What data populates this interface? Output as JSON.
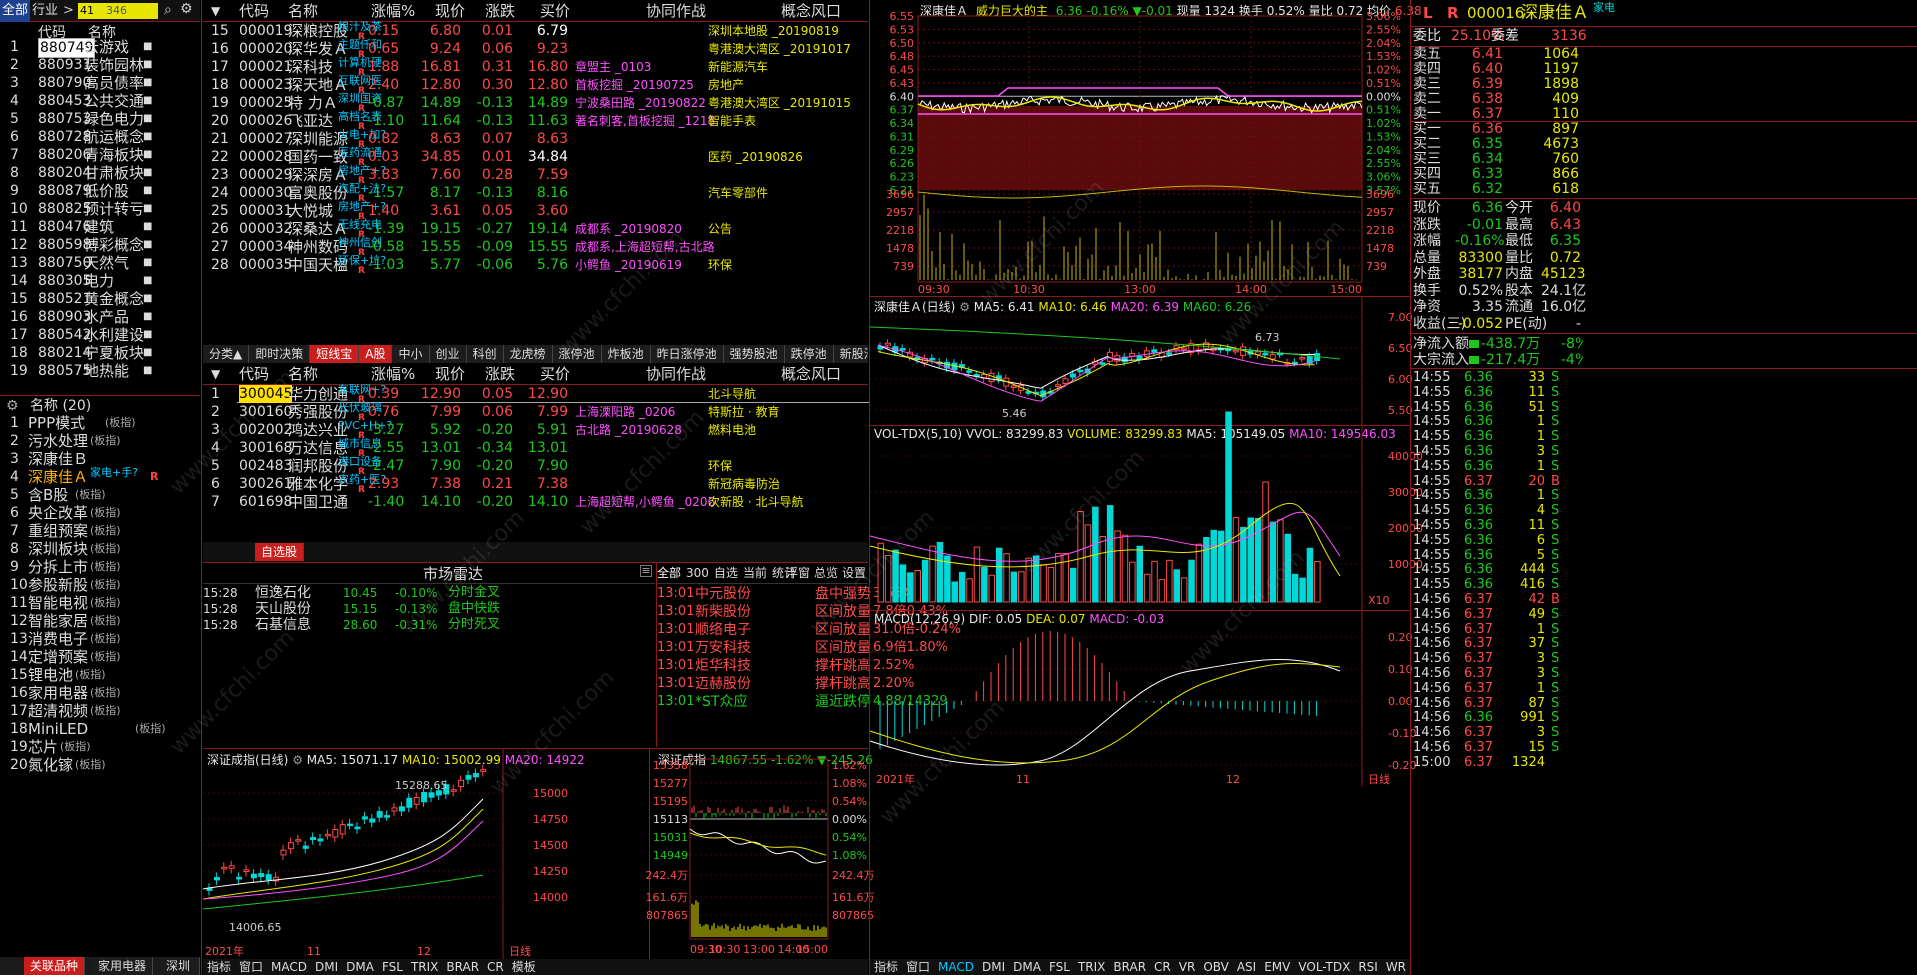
{
  "topbar": {
    "tab_all": "全部",
    "tab_industry": "行业",
    "search_val": "41",
    "search_count": "346"
  },
  "sector_list": {
    "headers": {
      "code": "代码",
      "name": "名称"
    },
    "rows": [
      {
        "n": "1",
        "code": "880749",
        "name": "云游戏",
        "sel": true
      },
      {
        "n": "2",
        "code": "880931",
        "name": "装饰园林"
      },
      {
        "n": "3",
        "code": "880790",
        "name": "高员债率"
      },
      {
        "n": "4",
        "code": "880453",
        "name": "公共交通"
      },
      {
        "n": "5",
        "code": "880753",
        "name": "绿色电力"
      },
      {
        "n": "6",
        "code": "880728",
        "name": "航运概念"
      },
      {
        "n": "7",
        "code": "880206",
        "name": "青海板块"
      },
      {
        "n": "8",
        "code": "880204",
        "name": "甘肃板块"
      },
      {
        "n": "9",
        "code": "880879",
        "name": "低价股"
      },
      {
        "n": "10",
        "code": "880825",
        "name": "预计转亏"
      },
      {
        "n": "11",
        "code": "880476",
        "name": "建筑"
      },
      {
        "n": "12",
        "code": "880598",
        "name": "博彩概念"
      },
      {
        "n": "13",
        "code": "880750",
        "name": "天然气"
      },
      {
        "n": "14",
        "code": "880305",
        "name": "电力"
      },
      {
        "n": "15",
        "code": "880521",
        "name": "黄金概念"
      },
      {
        "n": "16",
        "code": "880903",
        "name": "水产品"
      },
      {
        "n": "17",
        "code": "880542",
        "name": "水利建设"
      },
      {
        "n": "18",
        "code": "880214",
        "name": "宁夏板块"
      },
      {
        "n": "19",
        "code": "880575",
        "name": "地热能"
      }
    ]
  },
  "related_list": {
    "header": "名称 (20)",
    "rows": [
      {
        "n": "1",
        "name": "PPP模式",
        "tag": "(板指)"
      },
      {
        "n": "2",
        "name": "污水处理",
        "tag": "(板指)"
      },
      {
        "n": "3",
        "name": "深康佳Ｂ",
        "tag": ""
      },
      {
        "n": "4",
        "name": "深康佳Ａ",
        "tag": "家电+手?",
        "hl": true,
        "flag": "R"
      },
      {
        "n": "5",
        "name": "含B股",
        "tag": "(板指)"
      },
      {
        "n": "6",
        "name": "央企改革",
        "tag": "(板指)"
      },
      {
        "n": "7",
        "name": "重组预案",
        "tag": "(板指)"
      },
      {
        "n": "8",
        "name": "深圳板块",
        "tag": "(板指)"
      },
      {
        "n": "9",
        "name": "分拆上市",
        "tag": "(板指)"
      },
      {
        "n": "10",
        "name": "参股新股",
        "tag": "(板指)"
      },
      {
        "n": "11",
        "name": "智能电视",
        "tag": "(板指)"
      },
      {
        "n": "12",
        "name": "智能家居",
        "tag": "(板指)"
      },
      {
        "n": "13",
        "name": "消费电子",
        "tag": "(板指)"
      },
      {
        "n": "14",
        "name": "定增预案",
        "tag": "(板指)"
      },
      {
        "n": "15",
        "name": "锂电池",
        "tag": "(板指)"
      },
      {
        "n": "16",
        "name": "家用电器",
        "tag": "(板指)"
      },
      {
        "n": "17",
        "name": "超清视频",
        "tag": "(板指)"
      },
      {
        "n": "18",
        "name": "MiniLED",
        "tag": "(板指)"
      },
      {
        "n": "19",
        "name": "芯片",
        "tag": "(板指)"
      },
      {
        "n": "20",
        "name": "氮化镓",
        "tag": "(板指)"
      }
    ],
    "bottom_tabs": [
      "关联品种",
      "家用电器",
      "深圳板块"
    ]
  },
  "table_headers": {
    "code": "代码",
    "name": "名称",
    "pct": "涨幅%",
    "price": "现价",
    "chg": "涨跌",
    "bid": "买价",
    "coop": "协同作战",
    "concept": "概念风口"
  },
  "stock_table_1": [
    {
      "n": "15",
      "code": "000019",
      "name": "深粮控股",
      "tag": "粮汁及茶",
      "pct": "0.15",
      "price": "6.80",
      "chg": "0.01",
      "bid": "6.79",
      "coop": "",
      "concept": "深圳本地股 _20190819",
      "dir": "up",
      "bidw": true
    },
    {
      "n": "16",
      "code": "000020",
      "name": "深华发Ａ",
      "tag": "主题仟和",
      "pct": "0.65",
      "price": "9.24",
      "chg": "0.06",
      "bid": "9.23",
      "coop": "",
      "concept": "粤港澳大湾区 _20191017",
      "dir": "up"
    },
    {
      "n": "17",
      "code": "000021",
      "name": "深科技",
      "tag": "计算机硬",
      "pct": "1.88",
      "price": "16.81",
      "chg": "0.31",
      "bid": "16.80",
      "coop": "章盟主 _0103",
      "concept": "新能源汽车",
      "dir": "up"
    },
    {
      "n": "18",
      "code": "000023",
      "name": "深天地Ａ",
      "tag": "互联网医",
      "pct": "2.40",
      "price": "12.80",
      "chg": "0.30",
      "bid": "12.80",
      "coop": "首板挖掘 _20190725",
      "concept": "房地产",
      "dir": "up"
    },
    {
      "n": "19",
      "code": "000025",
      "name": "特 力Ａ",
      "tag": "深圳国资",
      "pct": "-0.87",
      "price": "14.89",
      "chg": "-0.13",
      "bid": "14.89",
      "coop": "宁波桑田路 _20190822",
      "concept": "粤港澳大湾区 _20191015",
      "dir": "dn"
    },
    {
      "n": "20",
      "code": "000026",
      "name": "飞亚达",
      "tag": "高档名表",
      "pct": "-1.10",
      "price": "11.64",
      "chg": "-0.13",
      "bid": "11.63",
      "coop": "著名刺客,首板挖掘 _1218",
      "concept": "智能手表",
      "dir": "dn"
    },
    {
      "n": "21",
      "code": "000027",
      "name": "深圳能源",
      "tag": "火电+加?",
      "pct": "0.82",
      "price": "8.63",
      "chg": "0.07",
      "bid": "8.63",
      "coop": "",
      "concept": "",
      "dir": "up"
    },
    {
      "n": "22",
      "code": "000028",
      "name": "国药一致",
      "tag": "医药流通",
      "pct": "0.03",
      "price": "34.85",
      "chg": "0.01",
      "bid": "34.84",
      "coop": "",
      "concept": "医药 _20190826",
      "dir": "up",
      "bidw": true
    },
    {
      "n": "23",
      "code": "000029",
      "name": "深深房Ａ",
      "tag": "房地产+?",
      "pct": "3.83",
      "price": "7.60",
      "chg": "0.28",
      "bid": "7.59",
      "coop": "",
      "concept": "",
      "dir": "up"
    },
    {
      "n": "24",
      "code": "000030",
      "name": "富奥股份",
      "tag": "汽配+法?",
      "pct": "-1.57",
      "price": "8.17",
      "chg": "-0.13",
      "bid": "8.16",
      "coop": "",
      "concept": "汽车零部件",
      "dir": "dn"
    },
    {
      "n": "25",
      "code": "000031",
      "name": "大悦城",
      "tag": "房地产+?",
      "pct": "1.40",
      "price": "3.61",
      "chg": "0.05",
      "bid": "3.60",
      "coop": "",
      "concept": "",
      "dir": "up"
    },
    {
      "n": "26",
      "code": "000032",
      "name": "深桑达Ａ",
      "tag": "无线充电",
      "pct": "-1.39",
      "price": "19.15",
      "chg": "-0.27",
      "bid": "19.14",
      "coop": "成都系 _20190820",
      "concept": "公告",
      "dir": "dn"
    },
    {
      "n": "27",
      "code": "000034",
      "name": "神州数码",
      "tag": "神州信创",
      "pct": "-0.58",
      "price": "15.55",
      "chg": "-0.09",
      "bid": "15.55",
      "coop": "成都系,上海超短帮,古北路",
      "concept": "",
      "dir": "dn"
    },
    {
      "n": "28",
      "code": "000035",
      "name": "中国天楹",
      "tag": "环保+垃?",
      "pct": "-1.03",
      "price": "5.77",
      "chg": "-0.06",
      "bid": "5.76",
      "coop": "小鳄鱼 _20190619",
      "concept": "环保",
      "dir": "dn"
    }
  ],
  "mid_tabs": [
    "分类▲",
    "即时决策",
    "短线宝",
    "A股",
    "中小",
    "创业",
    "科创",
    "龙虎榜",
    "涨停池",
    "炸板池",
    "昨日涨停池",
    "强势股池",
    "跌停池",
    "新股池"
  ],
  "stock_table_2": [
    {
      "n": "1",
      "code": "300045",
      "name": "华力创通",
      "tag": "车联网+?",
      "pct": "0.39",
      "price": "12.90",
      "chg": "0.05",
      "bid": "12.90",
      "coop": "",
      "concept": "北斗导航",
      "dir": "up",
      "sel": true
    },
    {
      "n": "2",
      "code": "300160",
      "name": "秀强股份",
      "tag": "光伏玻璃",
      "pct": "0.76",
      "price": "7.99",
      "chg": "0.06",
      "bid": "7.99",
      "coop": "上海溧阳路 _0206",
      "concept": "特斯拉 · 教育",
      "dir": "up"
    },
    {
      "n": "3",
      "code": "002002",
      "name": "鸿达兴业",
      "tag": "PVC+H+?",
      "pct": "-3.27",
      "price": "5.92",
      "chg": "-0.20",
      "bid": "5.91",
      "coop": "古北路 _20190628",
      "concept": "燃料电池",
      "dir": "dn"
    },
    {
      "n": "4",
      "code": "300168",
      "name": "万达信息",
      "tag": "城市信息",
      "pct": "-2.55",
      "price": "13.01",
      "chg": "-0.34",
      "bid": "13.01",
      "coop": "",
      "concept": "",
      "dir": "dn"
    },
    {
      "n": "5",
      "code": "002483",
      "name": "润邦股份",
      "tag": "港口设备",
      "pct": "-2.47",
      "price": "7.90",
      "chg": "-0.20",
      "bid": "7.90",
      "coop": "",
      "concept": "环保",
      "dir": "dn"
    },
    {
      "n": "6",
      "code": "300261",
      "name": "雅本化学",
      "tag": "农药+医?",
      "pct": "2.93",
      "price": "7.38",
      "chg": "0.21",
      "price_c": "r",
      "bid": "7.38",
      "coop": "",
      "concept": "新冠病毒防治",
      "dir": "up"
    },
    {
      "n": "7",
      "code": "601698",
      "name": "中国卫通",
      "tag": "",
      "pct": "-1.40",
      "price": "14.10",
      "chg": "-0.20",
      "bid": "14.10",
      "coop": "上海超短帮,小鳄鱼 _0206",
      "concept": "次新股 · 北斗导航",
      "dir": "dn"
    }
  ],
  "selfselect_tab": "自选股",
  "radar": {
    "title": "市场雷达",
    "rows": [
      {
        "t": "15:28",
        "name": "恒逸石化",
        "price": "10.45",
        "pct": "-0.10%",
        "sig": "分时金叉"
      },
      {
        "t": "15:28",
        "name": "天山股份",
        "price": "15.15",
        "pct": "-0.13%",
        "sig": "盘中快跌"
      },
      {
        "t": "15:28",
        "name": "石基信息",
        "price": "28.60",
        "pct": "-0.31%",
        "sig": "分时死叉"
      }
    ]
  },
  "alerts": {
    "tabs": [
      "全部",
      "300",
      "自选",
      "当前",
      "统计"
    ],
    "right": [
      "浮窗",
      "总览",
      "设置"
    ],
    "rows": [
      {
        "t": "13:01",
        "name": "中元股份",
        "sig": "盘中强势",
        "val": "3.56%"
      },
      {
        "t": "13:01",
        "name": "新柴股份",
        "sig": "区间放量",
        "val": "7.8倍0.43%"
      },
      {
        "t": "13:01",
        "name": "顺络电子",
        "sig": "区间放量",
        "val": "31.0倍-0.24%",
        "val_c": "g"
      },
      {
        "t": "13:01",
        "name": "万安科技",
        "sig": "区间放量",
        "val": "6.9倍1.80%"
      },
      {
        "t": "13:01",
        "name": "炬华科技",
        "sig": "撑杆跳高",
        "val": "2.52%"
      },
      {
        "t": "13:01",
        "name": "迈赫股份",
        "sig": "撑杆跳高",
        "val": "2.20%"
      },
      {
        "t": "13:01",
        "name": "*ST众应",
        "sig": "逼近跌停",
        "val": "4.88/14329",
        "green": true
      }
    ]
  },
  "sz_daily": {
    "title": "深证成指(日线)",
    "ma5": "MA5: 15071.17",
    "ma10": "MA10: 15002.99",
    "ma20": "MA20: 14922",
    "high": "15288.65",
    "low": "14006.65",
    "yticks": [
      "15000",
      "14750",
      "14500",
      "14250",
      "14000"
    ],
    "xlabels": [
      "2021年",
      "11",
      "12"
    ],
    "axis_label": "日线"
  },
  "sz_intraday": {
    "title": "深证成指",
    "val": "14867.55",
    "pct": "-1.62%",
    "chg": "▼-245.26",
    "yleft": [
      "15358",
      "15277",
      "15195",
      "15113",
      "15031",
      "14949",
      "242.4万",
      "161.6万",
      "807865"
    ],
    "yright": [
      "1.62%",
      "1.08%",
      "0.54%",
      "0.00%",
      "0.54%",
      "1.08%",
      "242.4万",
      "161.6万",
      "807865"
    ],
    "xlabels": [
      "09:30",
      "10:30",
      "13:00",
      "14:00",
      "15:00"
    ]
  },
  "intraday": {
    "title": "深康佳Ａ",
    "sig": "威力巨大的主",
    "last": "6.36",
    "pct": "-0.16%",
    "chg": "▼-0.01",
    "vol_l": "现量",
    "vol": "1324",
    "turn_l": "换手",
    "turn": "0.52%",
    "ratio_l": "量比",
    "ratio": "0.72",
    "avg_l": "均价",
    "avg": "6.38",
    "yleft": [
      "6.55",
      "6.53",
      "6.50",
      "6.48",
      "6.45",
      "6.43",
      "6.40",
      "6.37",
      "6.34",
      "6.31",
      "6.29",
      "6.26",
      "6.23",
      "6.21",
      "3696",
      "2957",
      "2218",
      "1478",
      "739"
    ],
    "yright": [
      "3.06%",
      "2.55%",
      "2.04%",
      "1.53%",
      "1.02%",
      "0.51%",
      "0.00%",
      "0.51%",
      "1.02%",
      "1.53%",
      "2.04%",
      "2.55%",
      "3.06%",
      "3.57%",
      "3696",
      "2957",
      "2218",
      "1478",
      "739"
    ],
    "xlabels": [
      "09:30",
      "10:30",
      "13:00",
      "14:00",
      "15:00"
    ]
  },
  "kline": {
    "title": "深康佳Ａ(日线)",
    "ma5": "MA5: 6.41",
    "ma10": "MA10: 6.46",
    "ma20": "MA20: 6.39",
    "ma60": "MA60: 6.26",
    "high": "6.73",
    "low": "5.46",
    "yticks": [
      "7.00",
      "6.50",
      "6.00",
      "5.50"
    ]
  },
  "vol_panel": {
    "title": "VOL-TDX(5,10)",
    "vvol": "VVOL: 83299.83",
    "volume": "VOLUME: 83299.83",
    "ma5": "MA5: 105149.05",
    "ma10": "MA10: 149546.03",
    "yticks": [
      "40000",
      "30000",
      "20000",
      "10000"
    ],
    "unit": "X10"
  },
  "macd_panel": {
    "title": "MACD(12,26,9)",
    "dif": "DIF: 0.05",
    "dea": "DEA: 0.07",
    "macd": "MACD: -0.03",
    "yticks": [
      "0.20",
      "0.10",
      "0.00",
      "-0.10",
      "-0.20"
    ],
    "xlabels": [
      "2021年",
      "11",
      "12"
    ],
    "axis_label": "日线"
  },
  "bottom_indicator_tabs": [
    "指标",
    "窗口",
    "MACD",
    "DMI",
    "DMA",
    "FSL",
    "TRIX",
    "BRAR",
    "CR",
    "VR",
    "OBV",
    "ASI",
    "EMV",
    "VOL-TDX",
    "RSI",
    "WR",
    "SAR",
    "模板"
  ],
  "bottom_small_tabs": [
    "指标",
    "窗口",
    "MACD",
    "DMI",
    "DMA",
    "FSL",
    "TRIX",
    "BRAR",
    "CR",
    "模板"
  ],
  "quote": {
    "code": "000016",
    "name": "深康佳Ａ",
    "tag": "家电",
    "weibi_l": "委比",
    "weibi": "25.10%",
    "weicha_l": "委差",
    "weicha": "3136",
    "asks": [
      {
        "l": "卖五",
        "p": "6.41",
        "v": "1064"
      },
      {
        "l": "卖四",
        "p": "6.40",
        "v": "1197"
      },
      {
        "l": "卖三",
        "p": "6.39",
        "v": "1898"
      },
      {
        "l": "卖二",
        "p": "6.38",
        "v": "409"
      },
      {
        "l": "卖一",
        "p": "6.37",
        "v": "110"
      }
    ],
    "bids": [
      {
        "l": "买一",
        "p": "6.36",
        "v": "897"
      },
      {
        "l": "买二",
        "p": "6.35",
        "v": "4673"
      },
      {
        "l": "买三",
        "p": "6.34",
        "v": "760"
      },
      {
        "l": "买四",
        "p": "6.33",
        "v": "866"
      },
      {
        "l": "买五",
        "p": "6.32",
        "v": "618"
      }
    ],
    "stats": [
      [
        "现价",
        "6.36",
        "今开",
        "6.40"
      ],
      [
        "涨跌",
        "-0.01",
        "最高",
        "6.43"
      ],
      [
        "涨幅",
        "-0.16%",
        "最低",
        "6.35"
      ],
      [
        "总量",
        "83300",
        "量比",
        "0.72"
      ],
      [
        "外盘",
        "38177",
        "内盘",
        "45123"
      ],
      [
        "换手",
        "0.52%",
        "股本",
        "24.1亿"
      ],
      [
        "净资",
        "3.35",
        "流通",
        "16.0亿"
      ],
      [
        "收益(三)",
        "-0.052",
        "PE(动)",
        "-"
      ]
    ],
    "flow": [
      [
        "净流入额",
        "-438.7万",
        "-8%"
      ],
      [
        "大宗流入",
        "-217.4万",
        "-4%"
      ]
    ],
    "ticks": [
      [
        "14:55",
        "6.36",
        "33",
        "S"
      ],
      [
        "14:55",
        "6.36",
        "11",
        "S"
      ],
      [
        "14:55",
        "6.36",
        "51",
        "S"
      ],
      [
        "14:55",
        "6.36",
        "1",
        "S"
      ],
      [
        "14:55",
        "6.36",
        "1",
        "S"
      ],
      [
        "14:55",
        "6.36",
        "3",
        "S"
      ],
      [
        "14:55",
        "6.36",
        "1",
        "S"
      ],
      [
        "14:55",
        "6.37",
        "20",
        "B"
      ],
      [
        "14:55",
        "6.36",
        "1",
        "S"
      ],
      [
        "14:55",
        "6.36",
        "4",
        "S"
      ],
      [
        "14:55",
        "6.36",
        "11",
        "S"
      ],
      [
        "14:55",
        "6.36",
        "6",
        "S"
      ],
      [
        "14:55",
        "6.36",
        "5",
        "S"
      ],
      [
        "14:55",
        "6.36",
        "444",
        "S"
      ],
      [
        "14:55",
        "6.36",
        "416",
        "S"
      ],
      [
        "14:56",
        "6.37",
        "42",
        "B"
      ],
      [
        "14:56",
        "6.37",
        "49",
        "S"
      ],
      [
        "14:56",
        "6.37",
        "1",
        "S"
      ],
      [
        "14:56",
        "6.37",
        "37",
        "S"
      ],
      [
        "14:56",
        "6.37",
        "3",
        "S"
      ],
      [
        "14:56",
        "6.37",
        "3",
        "S"
      ],
      [
        "14:56",
        "6.37",
        "1",
        "S"
      ],
      [
        "14:56",
        "6.37",
        "87",
        "S"
      ],
      [
        "14:56",
        "6.36",
        "991",
        "S"
      ],
      [
        "14:56",
        "6.37",
        "3",
        "S"
      ],
      [
        "14:56",
        "6.37",
        "15",
        "S"
      ],
      [
        "15:00",
        "6.37",
        "1324",
        ""
      ]
    ]
  },
  "watermark": "www.cfchi.com",
  "colors": {
    "up": "#ff4a4a",
    "down": "#1ec81e",
    "accent": "#c81e1e",
    "cyan": "#00d8d8",
    "yellow": "#e8e800",
    "magenta": "#ff50ff",
    "border": "#8b1a1a"
  }
}
